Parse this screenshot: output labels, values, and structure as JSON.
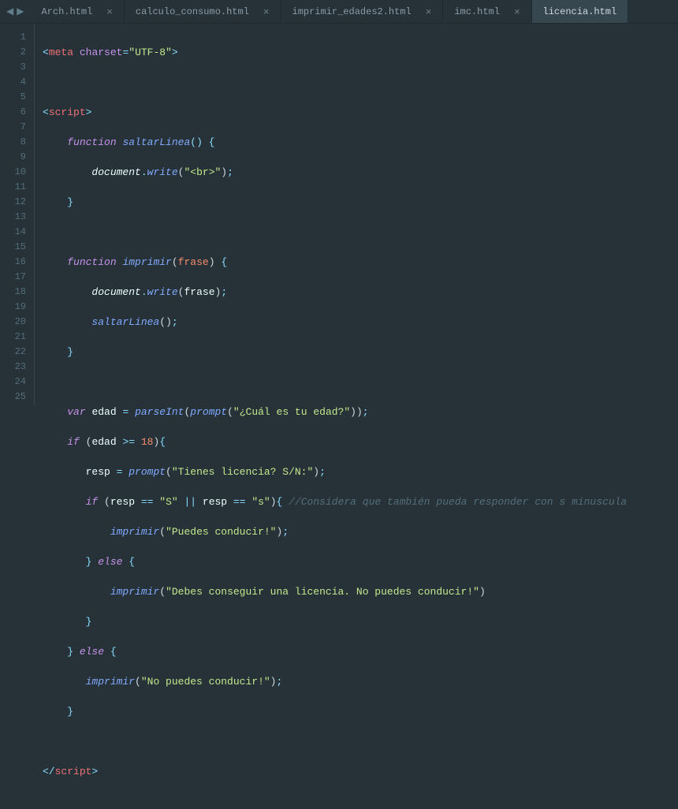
{
  "nav": {
    "back": "◀",
    "forward": "▶"
  },
  "tabs": [
    {
      "label": "Arch.html",
      "active": false
    },
    {
      "label": "calculo_consumo.html",
      "active": false
    },
    {
      "label": "imprimir_edades2.html",
      "active": false
    },
    {
      "label": "imc.html",
      "active": false
    },
    {
      "label": "licencia.html",
      "active": true
    }
  ],
  "gutter": [
    "1",
    "2",
    "3",
    "4",
    "5",
    "6",
    "7",
    "8",
    "9",
    "10",
    "11",
    "12",
    "13",
    "14",
    "15",
    "16",
    "17",
    "18",
    "19",
    "20",
    "21",
    "22",
    "23",
    "24",
    "25"
  ],
  "code": {
    "l1": {
      "open": "<",
      "tag": "meta",
      "attr": "charset",
      "eq": "=",
      "val": "\"UTF-8\"",
      "close": ">"
    },
    "l3": {
      "open": "<",
      "tag": "script",
      "close": ">"
    },
    "l4": {
      "kw": "function",
      "name": "saltarLinea",
      "p": "() {"
    },
    "l5": {
      "obj": "document",
      "dot": ".",
      "fn": "write",
      "po": "(",
      "str": "\"<br>\"",
      "pc": ")",
      "sc": ";"
    },
    "l6": {
      "brace": "}"
    },
    "l8": {
      "kw": "function",
      "name": "imprimir",
      "po": "(",
      "arg": "frase",
      "pc": ")",
      "brace": " {"
    },
    "l9": {
      "obj": "document",
      "dot": ".",
      "fn": "write",
      "po": "(",
      "arg": "frase",
      "pc": ")",
      "sc": ";"
    },
    "l10": {
      "fn": "saltarLinea",
      "po": "(",
      "pc": ")",
      "sc": ";"
    },
    "l11": {
      "brace": "}"
    },
    "l13": {
      "kw": "var",
      "name": "edad",
      "eq": " = ",
      "fn": "parseInt",
      "po": "(",
      "fn2": "prompt",
      "po2": "(",
      "str": "\"¿Cuál es tu edad?\"",
      "pc2": ")",
      "pc": ")",
      "sc": ";"
    },
    "l14": {
      "kw": "if",
      "po": " (",
      "var": "edad",
      "op": " >= ",
      "num": "18",
      "pc": ")",
      "brace": "{"
    },
    "l15": {
      "var": "resp",
      "eq": " = ",
      "fn": "prompt",
      "po": "(",
      "str": "\"Tienes licencia? S/N:\"",
      "pc": ")",
      "sc": ";"
    },
    "l16": {
      "kw": "if",
      "po": " (",
      "var": "resp",
      "op": " == ",
      "str": "\"S\"",
      "or": " || ",
      "var2": "resp",
      "op2": " == ",
      "str2": "\"s\"",
      "pc": ")",
      "brace": "{ ",
      "comm": "//Considera que también pueda responder con s minuscula"
    },
    "l17": {
      "fn": "imprimir",
      "po": "(",
      "str": "\"Puedes conducir!\"",
      "pc": ")",
      "sc": ";"
    },
    "l18": {
      "cb": "}",
      "kw": " else ",
      "ob": "{"
    },
    "l19": {
      "fn": "imprimir",
      "po": "(",
      "str": "\"Debes conseguir una licencia. No puedes conducir!\"",
      "pc": ")"
    },
    "l20": {
      "brace": "}"
    },
    "l21": {
      "cb": "}",
      "kw": " else ",
      "ob": "{"
    },
    "l22": {
      "fn": "imprimir",
      "po": "(",
      "str": "\"No puedes conducir!\"",
      "pc": ")",
      "sc": ";"
    },
    "l23": {
      "brace": "}"
    },
    "l25": {
      "open": "</",
      "tag": "script",
      "close": ">"
    }
  }
}
